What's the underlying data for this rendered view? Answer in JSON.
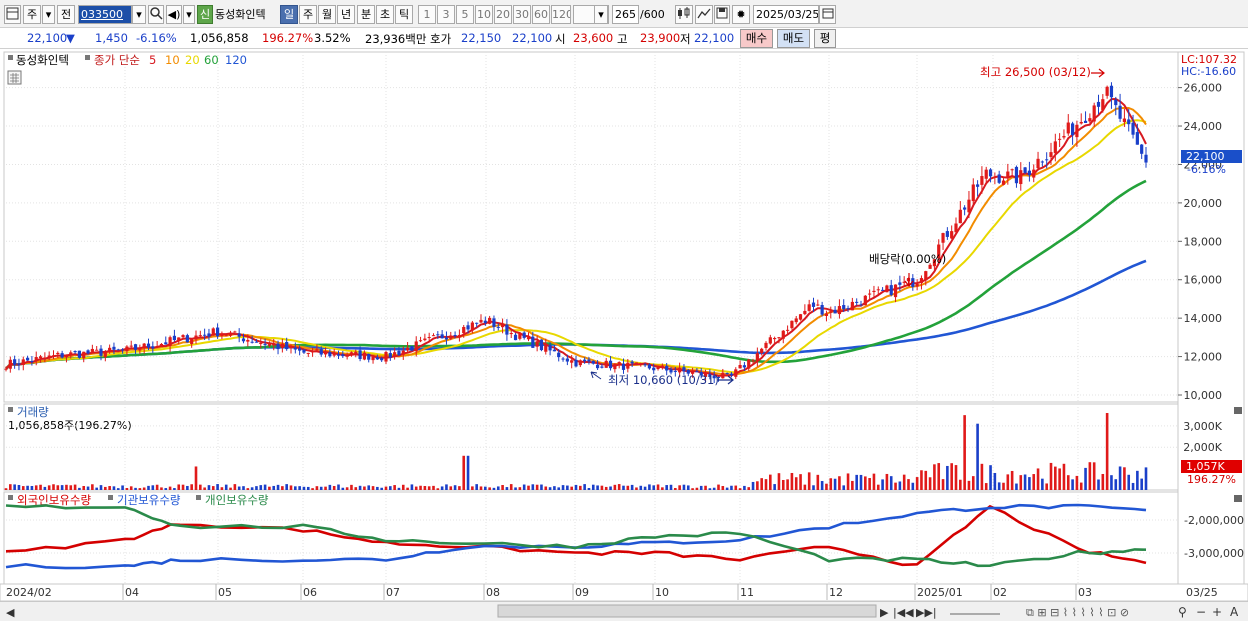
{
  "toolbar": {
    "period_label": "주",
    "prev_label": "전",
    "stock_code": "033500",
    "market_badge": "신",
    "stock_name": "동성화인텍",
    "period_tabs": [
      "일",
      "주",
      "월",
      "년",
      "분",
      "초",
      "틱"
    ],
    "minute_options": [
      "1",
      "3",
      "5",
      "10",
      "20",
      "30",
      "60",
      "120"
    ],
    "count_value": "265",
    "count_total": "/600",
    "date_value": "2025/03/25"
  },
  "quote": {
    "price": "22,100",
    "arrow": "▼",
    "change": "1,450",
    "change_pct": "-6.16%",
    "volume": "1,056,858",
    "volume_pct": "196.27%",
    "turnover_pct": "3.52%",
    "amount": "23,936백만",
    "hoga_label": "호가",
    "hoga_ask": "22,150",
    "hoga_bid": "22,100",
    "open_label": "시",
    "open_value": "23,600",
    "high_label": "고",
    "high_value": "23,900",
    "low_label": "저",
    "low_value": "22,100",
    "buy_label": "매수",
    "sell_label": "매도",
    "eval_label": "평"
  },
  "price_panel": {
    "legend_name": "동성화인텍",
    "legend_series": "종가 단순",
    "ma_periods": [
      "5",
      "10",
      "20",
      "60",
      "120"
    ],
    "ma_colors": [
      "#d71920",
      "#f28c00",
      "#e8d800",
      "#23a23a",
      "#2156d4"
    ],
    "lc_label": "LC:107.32",
    "hc_label": "HC:-16.60",
    "y_ticks": [
      "26,000",
      "24,000",
      "22,000",
      "20,000",
      "18,000",
      "16,000",
      "14,000",
      "12,000",
      "10,000"
    ],
    "current_price_tag": "22,100",
    "current_pct_tag": "-6.16%",
    "high_annotation": "최고 26,500 (03/12)",
    "low_annotation": "최저 10,660 (10/31)",
    "dividend_annotation": "배당락(0.00%)"
  },
  "volume_panel": {
    "title": "거래량",
    "subtitle": "1,056,858주(196.27%)",
    "y_ticks": [
      "3,000K",
      "2,000K"
    ],
    "current_tag": "1,057K",
    "current_pct_tag": "196.27%"
  },
  "holdings_panel": {
    "legend": [
      "외국인보유수량",
      "기관보유수량",
      "개인보유수량"
    ],
    "legend_colors": [
      "#d40000",
      "#2156d4",
      "#2a8a4a"
    ],
    "y_ticks": [
      "-2,000,000",
      "-3,000,000"
    ]
  },
  "x_axis": {
    "labels": [
      "2024/02",
      "04",
      "05",
      "06",
      "07",
      "08",
      "09",
      "10",
      "11",
      "12",
      "2025/01",
      "02",
      "03",
      "03/25"
    ]
  },
  "chart_data": {
    "type": "candlestick",
    "title": "동성화인텍",
    "period": "daily",
    "x_range": [
      "2024/02",
      "2025/03/25"
    ],
    "price_ylim": [
      10000,
      26500
    ],
    "price_ticks": [
      10000,
      12000,
      14000,
      16000,
      18000,
      20000,
      22000,
      24000,
      26000
    ],
    "last_close": 22100,
    "all_time_high": {
      "date": "03/12",
      "value": 26500
    },
    "all_time_low": {
      "date": "10/31",
      "value": 10660
    },
    "close_path": [
      {
        "x": "2024/02",
        "y": 11600
      },
      {
        "x": "03",
        "y": 12100
      },
      {
        "x": "04",
        "y": 12300
      },
      {
        "x": "05",
        "y": 13300
      },
      {
        "x": "06",
        "y": 12200
      },
      {
        "x": "07",
        "y": 12000
      },
      {
        "x": "08",
        "y": 13900
      },
      {
        "x": "08 end",
        "y": 13000
      },
      {
        "x": "09",
        "y": 11700
      },
      {
        "x": "10",
        "y": 11400
      },
      {
        "x": "10/31",
        "y": 10900
      },
      {
        "x": "11",
        "y": 12300
      },
      {
        "x": "11 mid",
        "y": 14700
      },
      {
        "x": "12",
        "y": 14300
      },
      {
        "x": "2025/01",
        "y": 16000
      },
      {
        "x": "01 end",
        "y": 21500
      },
      {
        "x": "02",
        "y": 21300
      },
      {
        "x": "03",
        "y": 24200
      },
      {
        "x": "03/12",
        "y": 25800
      },
      {
        "x": "03/25",
        "y": 22100
      }
    ],
    "moving_averages": [
      {
        "name": "5",
        "last": 23800
      },
      {
        "name": "10",
        "last": 24000
      },
      {
        "name": "20",
        "last": 23500
      },
      {
        "name": "60",
        "last": 20300
      },
      {
        "name": "120",
        "last": 16400
      }
    ],
    "volume_ylim": [
      0,
      3600000
    ],
    "volume_last": 1056858,
    "holdings_ylim": [
      -3500000,
      -1500000
    ],
    "holdings_series": [
      {
        "name": "외국인보유수량",
        "points": [
          -3000000,
          -2600000,
          -2100000,
          -2300000,
          -2700000,
          -2800000,
          -3000000,
          -3000000,
          -3200000,
          -2800000,
          -3400000,
          -1600000,
          -2900000,
          -3300000
        ]
      },
      {
        "name": "기관보유수량",
        "points": [
          -3400000,
          -3400000,
          -3200000,
          -3200000,
          -3200000,
          -2800000,
          -2800000,
          -2700000,
          -2600000,
          -2200000,
          -1800000,
          -1600000,
          -1600000,
          -1700000
        ]
      },
      {
        "name": "개인보유수량",
        "points": [
          -1600000,
          -1600000,
          -2200000,
          -2200000,
          -2600000,
          -2700000,
          -2800000,
          -2500000,
          -2400000,
          -3200000,
          -3200000,
          -3400000,
          -3000000,
          -2900000
        ]
      }
    ]
  }
}
